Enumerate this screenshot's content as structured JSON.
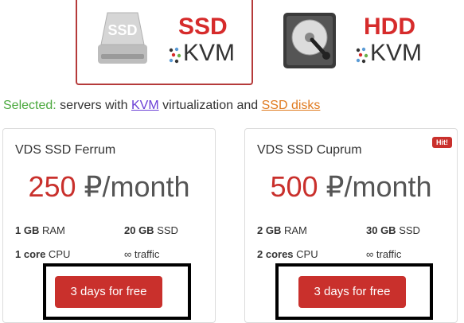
{
  "selectors": {
    "ssd": {
      "type": "SSD",
      "virt": "KVM",
      "selected": true
    },
    "hdd": {
      "type": "HDD",
      "virt": "KVM",
      "selected": false
    }
  },
  "selected_line": {
    "label": "Selected:",
    "text1": " servers with ",
    "kvm_link": "KVM",
    "text2": " virtualization and ",
    "ssd_link": "SSD disks"
  },
  "plans": [
    {
      "title": "VDS SSD Ferrum",
      "price_num": "250",
      "price_unit": " ₽/month",
      "ram_val": "1 GB",
      "ram_lbl": " RAM",
      "disk_val": "20 GB",
      "disk_lbl": " SSD",
      "cpu_val": "1 core",
      "cpu_lbl": " CPU",
      "traffic": "∞ traffic",
      "button": "3 days for free"
    },
    {
      "title": "VDS SSD Cuprum",
      "badge": "Hit!",
      "price_num": "500",
      "price_unit": " ₽/month",
      "ram_val": "2 GB",
      "ram_lbl": " RAM",
      "disk_val": "30 GB",
      "disk_lbl": " SSD",
      "cpu_val": "2 cores",
      "cpu_lbl": " CPU",
      "traffic": "∞ traffic",
      "button": "3 days for free"
    }
  ],
  "colors": {
    "accent": "#c9302c",
    "selected_label": "#4aa83d",
    "kvm_link": "#6a3fd6",
    "ssd_link": "#e07a1f"
  }
}
